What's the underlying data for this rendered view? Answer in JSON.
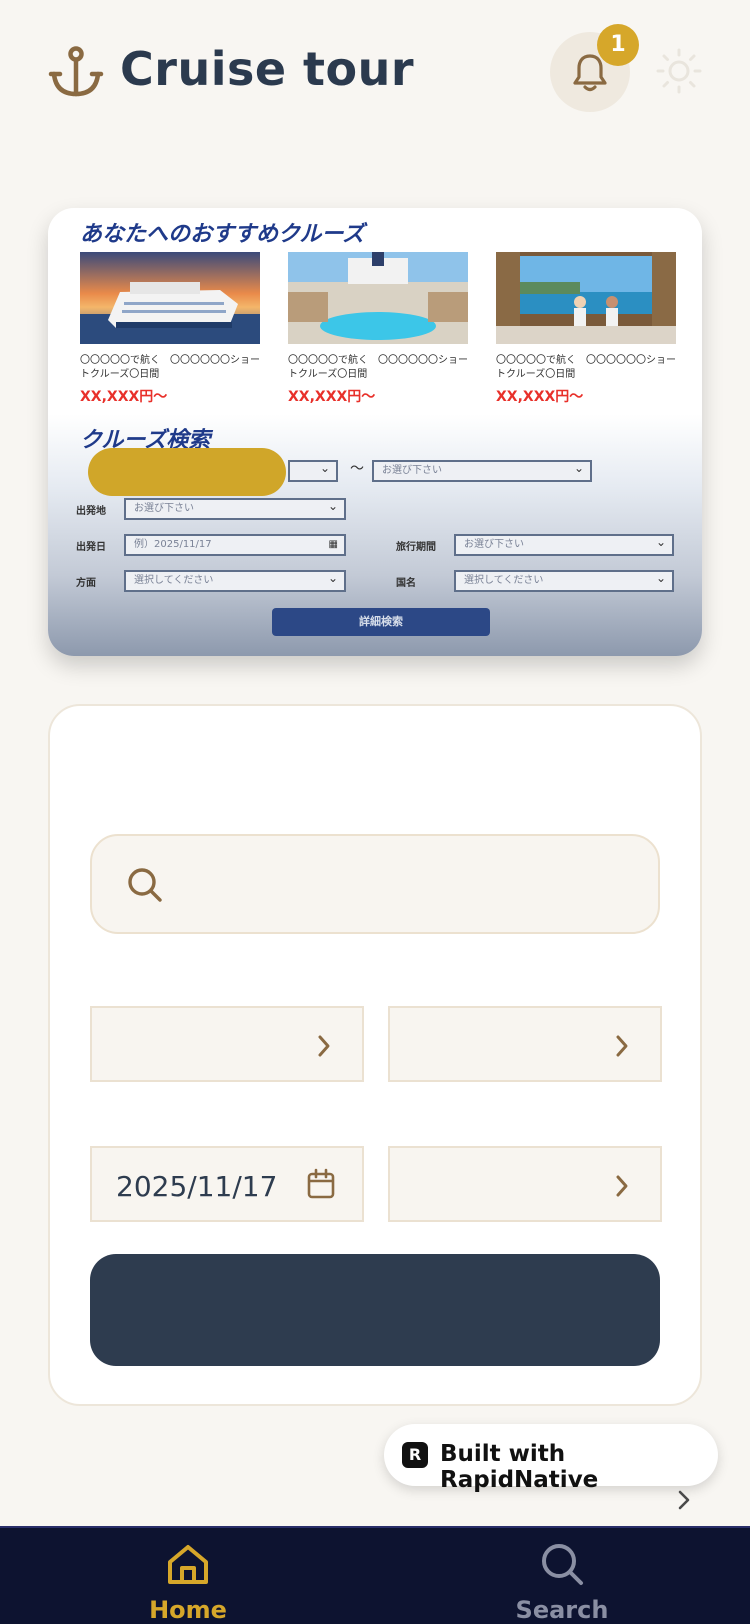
{
  "app": {
    "title": "Cruise tour",
    "notification_count": "1"
  },
  "hero": {
    "recommend_title": "あなたへのおすすめクルーズ",
    "cruises": [
      {
        "desc": "〇〇〇〇〇で航く　〇〇〇〇〇〇ショートクルーズ〇日間",
        "price": "XX,XXX円〜"
      },
      {
        "desc": "〇〇〇〇〇で航く　〇〇〇〇〇〇ショートクルーズ〇日間",
        "price": "XX,XXX円〜"
      },
      {
        "desc": "〇〇〇〇〇で航く　〇〇〇〇〇〇ショートクルーズ〇日間",
        "price": "XX,XXX円〜"
      }
    ],
    "search_title": "クルーズ検索",
    "select_placeholder": "お選び下さい",
    "tilde": "〜",
    "label_departure_port": "出発地",
    "label_departure_date": "出発日",
    "date_placeholder": "例）2025/11/17",
    "label_duration": "旅行期間",
    "label_region": "方面",
    "region_placeholder": "選択してください",
    "label_country": "国名",
    "country_placeholder": "選択してください",
    "detail_search_button": "詳細検索"
  },
  "search_form": {
    "date_value": "2025/11/17"
  },
  "built_with": "Built with RapidNative",
  "tabs": [
    {
      "label": "Home",
      "active": true
    },
    {
      "label": "Search",
      "active": false
    }
  ],
  "colors": {
    "accent": "#d6a72a",
    "navy": "#2e3c4f",
    "tabbar": "#0d1330"
  }
}
